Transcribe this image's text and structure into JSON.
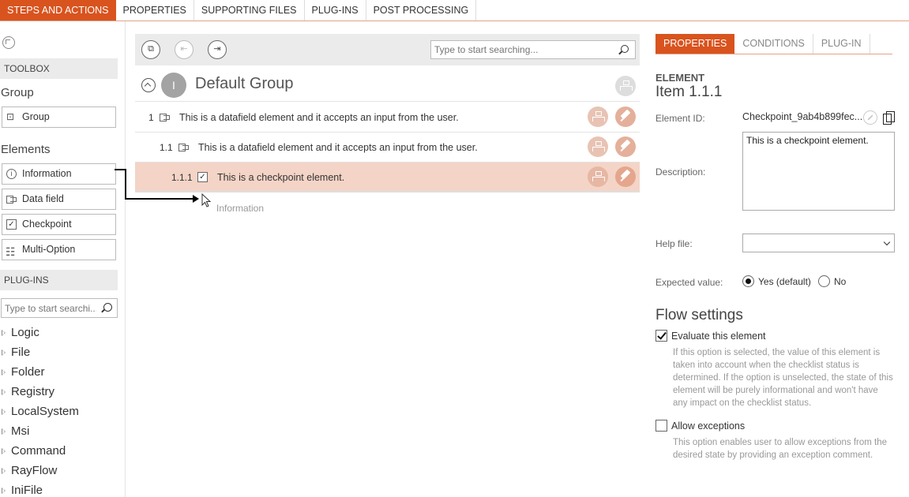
{
  "top_tabs": [
    "STEPS AND ACTIONS",
    "PROPERTIES",
    "SUPPORTING FILES",
    "PLUG-INS",
    "POST PROCESSING"
  ],
  "colors": {
    "accent": "#d9531e",
    "selected_row": "#f4d4c6",
    "panel_header": "#ebebeb"
  },
  "left": {
    "toolbox_header": "TOOLBOX",
    "group_label": "Group",
    "group_button": "Group",
    "elements_label": "Elements",
    "element_buttons": [
      "Information",
      "Data field",
      "Checkpoint",
      "Multi-Option"
    ],
    "plugins_header": "PLUG-INS",
    "search_placeholder": "Type to start searchi...",
    "plugins": [
      "Logic",
      "File",
      "Folder",
      "Registry",
      "LocalSystem",
      "Msi",
      "Command",
      "RayFlow",
      "IniFile"
    ]
  },
  "middle": {
    "search_placeholder": "Type to start searching...",
    "group_badge": "I",
    "group_title": "Default Group",
    "rows": [
      {
        "num": "1",
        "text": "This is a datafield element and it accepts an input from the user."
      },
      {
        "num": "1.1",
        "text": "This is a datafield element and it accepts an input from the user."
      },
      {
        "num": "1.1.1",
        "text": "This is a checkpoint element."
      }
    ],
    "drop_ghost": "Information"
  },
  "right": {
    "tabs": [
      "PROPERTIES",
      "CONDITIONS",
      "PLUG-IN"
    ],
    "element_header": "ELEMENT",
    "element_item": "Item  1.1.1",
    "element_id_label": "Element ID:",
    "element_id_value": "Checkpoint_9ab4b899fec...",
    "description_label": "Description:",
    "description_value": "This is a checkpoint element.",
    "help_file_label": "Help file:",
    "help_file_value": "",
    "expected_label": "Expected value:",
    "expected_yes": "Yes (default)",
    "expected_no": "No",
    "flow_header": "Flow settings",
    "evaluate_label": "Evaluate this element",
    "evaluate_help": "If this option is selected, the value of this element is taken into account when the checklist status is determined. If the option is unselected, the state of this element will be purely informational and won't have any impact on the checklist status.",
    "exceptions_label": "Allow exceptions",
    "exceptions_help": "This option enables user to allow exceptions from the desired state by providing an exception comment."
  }
}
